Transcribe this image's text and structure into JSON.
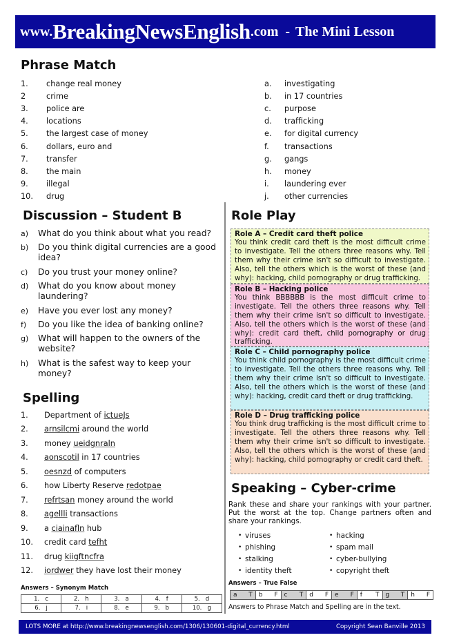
{
  "header": {
    "prefix": "www.",
    "brand": "BreakingNewsEnglish",
    "suffix": ".com",
    "separator": "-",
    "lesson_type": "The Mini Lesson"
  },
  "phrase_match": {
    "title": "Phrase Match",
    "left": [
      {
        "num": "1.",
        "text": "change real money"
      },
      {
        "num": "2",
        "text": "crime"
      },
      {
        "num": "3.",
        "text": "police are"
      },
      {
        "num": "4.",
        "text": "locations"
      },
      {
        "num": "5.",
        "text": "the largest case of money"
      },
      {
        "num": "6.",
        "text": "dollars, euro and"
      },
      {
        "num": "7.",
        "text": "transfer"
      },
      {
        "num": "8.",
        "text": "the main"
      },
      {
        "num": "9.",
        "text": "illegal"
      },
      {
        "num": "10.",
        "text": "drug"
      }
    ],
    "right": [
      {
        "num": "a.",
        "text": "investigating"
      },
      {
        "num": "b.",
        "text": "in 17 countries"
      },
      {
        "num": "c.",
        "text": "purpose"
      },
      {
        "num": "d.",
        "text": "trafficking"
      },
      {
        "num": "e.",
        "text": "for digital currency"
      },
      {
        "num": "f.",
        "text": "transactions"
      },
      {
        "num": "g.",
        "text": "gangs"
      },
      {
        "num": "h.",
        "text": "money"
      },
      {
        "num": "i.",
        "text": "laundering ever"
      },
      {
        "num": "j.",
        "text": "other currencies"
      }
    ]
  },
  "discussion": {
    "title": "Discussion – Student B",
    "items": [
      {
        "label": "a)",
        "text": "What do you think about what you read?"
      },
      {
        "label": "b)",
        "text": "Do you think digital currencies are a good idea?"
      },
      {
        "label": "c)",
        "text": "Do you trust your money online?"
      },
      {
        "label": "d)",
        "text": "What do you know about money laundering?"
      },
      {
        "label": "e)",
        "text": "Have you ever lost any money?"
      },
      {
        "label": "f)",
        "text": "Do you like the idea of banking online?"
      },
      {
        "label": "g)",
        "text": "What will happen to the owners of the website?"
      },
      {
        "label": "h)",
        "text": "What is the safest way to keep your money?"
      }
    ]
  },
  "spelling": {
    "title": "Spelling",
    "items": [
      {
        "num": "1.",
        "before": "Department of ",
        "word": "ictueJs",
        "after": ""
      },
      {
        "num": "2.",
        "before": "",
        "word": "arnsilcmi",
        "after": " around the world"
      },
      {
        "num": "3.",
        "before": "money ",
        "word": "ueidgnraln",
        "after": ""
      },
      {
        "num": "4.",
        "before": "",
        "word": "aonscotil",
        "after": " in 17 countries"
      },
      {
        "num": "5.",
        "before": "",
        "word": "oesnzd",
        "after": " of computers"
      },
      {
        "num": "6.",
        "before": "how Liberty Reserve ",
        "word": "redotpae",
        "after": ""
      },
      {
        "num": "7.",
        "before": "",
        "word": "refrtsan",
        "after": " money around the world"
      },
      {
        "num": "8.",
        "before": "",
        "word": "agellli",
        "after": " transactions"
      },
      {
        "num": "9.",
        "before": "a ",
        "word": "ciainafln",
        "after": " hub"
      },
      {
        "num": "10.",
        "before": "credit card ",
        "word": "tefht",
        "after": ""
      },
      {
        "num": "11.",
        "before": "drug ",
        "word": "kiigftncfra",
        "after": ""
      },
      {
        "num": "12.",
        "before": "",
        "word": "iordwer",
        "after": " they have lost their money"
      }
    ]
  },
  "answers_synonym": {
    "title": "Answers – Synonym Match",
    "rows": [
      [
        "1.   c",
        "2.   h",
        "3.   a",
        "4.   f",
        "5.   d"
      ],
      [
        "6.   j",
        "7.   i",
        "8.   e",
        "9.   b",
        "10.   g"
      ]
    ]
  },
  "role_play": {
    "title": "Role Play",
    "roles": [
      {
        "title": "Role  A – Credit card theft police",
        "text": "You think credit card theft is the most difficult crime to investigate. Tell the others three reasons why. Tell them why their crime isn't so difficult to investigate. Also, tell the others which is the worst of these (and why): hacking, child pornography or drug trafficking.",
        "color": "#f0f8c8"
      },
      {
        "title": "Role  B – Hacking police",
        "text": "You think BBBBBB is the most difficult crime to investigate. Tell the others three reasons why. Tell them why their crime isn't so difficult to investigate. Also, tell the others which is the worst of these (and why): credit card theft, child pornography or drug trafficking.",
        "color": "#f9c8e0"
      },
      {
        "title": "Role  C – Child pornography police",
        "text": "You think child pornography is the most difficult crime to investigate. Tell the others three reasons why. Tell them why their crime isn't so difficult to investigate. Also, tell the others which is the worst of these (and why): hacking, credit card theft or drug trafficking.",
        "color": "#c8f0f4"
      },
      {
        "title": "Role  D – Drug trafficking police",
        "text": "You think drug trafficking is the most difficult crime to investigate. Tell the others three reasons why. Tell them why their crime isn't so difficult to investigate. Also, tell the others which is the worst of these (and why): hacking, child pornography or credit card theft.",
        "color": "#fadfcc"
      }
    ]
  },
  "speaking": {
    "title": "Speaking – Cyber-crime",
    "intro": "Rank these and share your rankings with your partner. Put the worst at the top. Change partners often and share your rankings.",
    "bullet": "•",
    "left": [
      "viruses",
      "phishing",
      "stalking",
      "identity theft"
    ],
    "right": [
      "hacking",
      "spam mail",
      "cyber-bullying",
      "copyright theft"
    ]
  },
  "answers_true_false": {
    "title": "Answers – True False",
    "cells": [
      {
        "q": "a",
        "a": "T",
        "shaded": true
      },
      {
        "q": "b",
        "a": "F",
        "shaded": false
      },
      {
        "q": "c",
        "a": "T",
        "shaded": true
      },
      {
        "q": "d",
        "a": "F",
        "shaded": false
      },
      {
        "q": "e",
        "a": "F",
        "shaded": true
      },
      {
        "q": "f",
        "a": "T",
        "shaded": false
      },
      {
        "q": "g",
        "a": "T",
        "shaded": true
      },
      {
        "q": "h",
        "a": "F",
        "shaded": false
      }
    ],
    "note": "Answers to Phrase Match and Spelling are in the text."
  },
  "footer": {
    "link_text": "LOTS MORE at http://www.breakingnewsenglish.com/1306/130601-digital_currency.html",
    "copyright": "Copyright Sean Banville 2013"
  },
  "colors": {
    "brand_blue": "#0a0a9a"
  }
}
